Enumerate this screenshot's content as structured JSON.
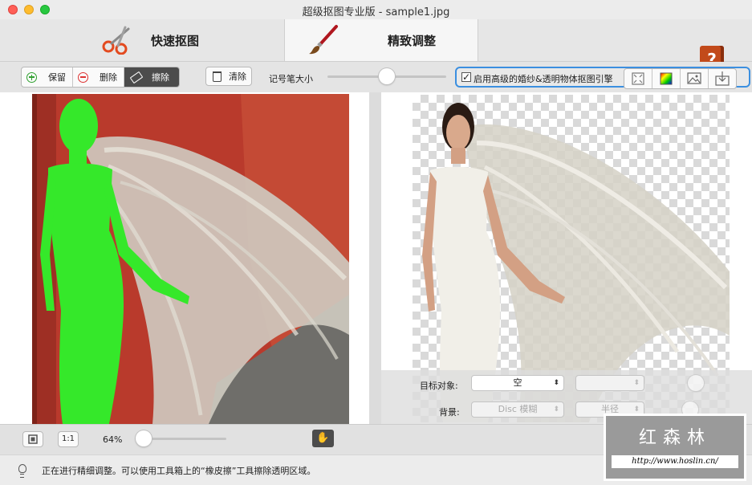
{
  "window": {
    "title": "超级抠图专业版 - sample1.jpg"
  },
  "modes": {
    "quick": "快速抠图",
    "fine": "精致调整",
    "help_icon": "help-book-icon",
    "help_glyph": "?"
  },
  "toolbar": {
    "keep": "保留",
    "delete": "删除",
    "erase": "擦除",
    "clear": "清除",
    "brush_size_label": "记号笔大小",
    "brush_size_level": 0.5,
    "advanced_checkbox_label": "启用高级的婚纱&透明物体抠图引擎",
    "advanced_checked": true,
    "check_glyph": "✓"
  },
  "options": {
    "target_label": "目标对象:",
    "target_value": "空",
    "background_label": "背景:",
    "background_value": "Disc 模糊",
    "radius_value": "半径"
  },
  "bottom": {
    "fit_icon": "fit-screen-icon",
    "actual_size": "1:1",
    "zoom": "64%",
    "zoom_level": 0.1,
    "hand_icon": "hand-icon",
    "hand_glyph": "✋"
  },
  "status": {
    "text": "正在进行精细调整。可以使用工具箱上的“橡皮擦”工具擦除透明区域。"
  },
  "watermark": {
    "brand": "红森林",
    "url": "http://www.hoslin.cn/"
  },
  "colors": {
    "accent": "#3b8fe0",
    "keep_green": "#2ea02e",
    "delete_red": "#dd3333",
    "mask_green": "#35e82a",
    "backdrop_red": "#b93a2c"
  }
}
